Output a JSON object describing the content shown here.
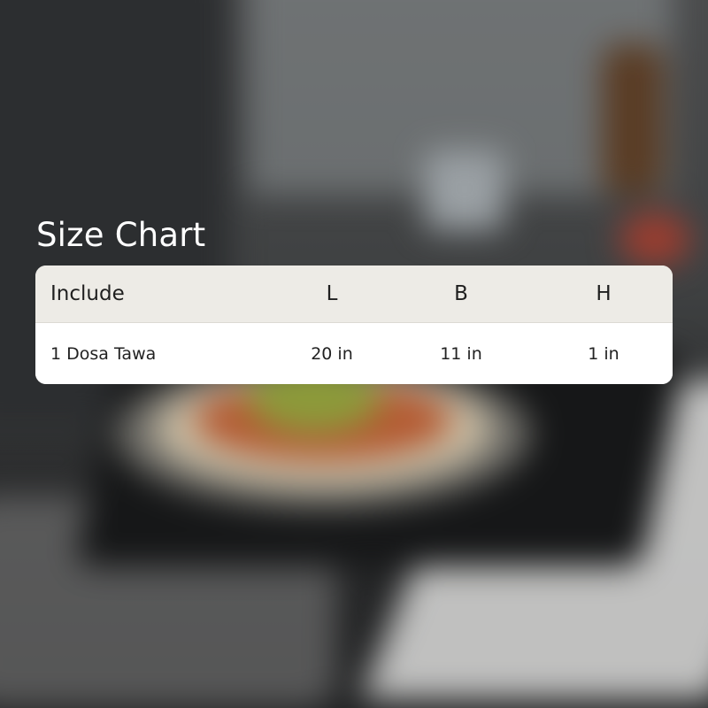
{
  "title": "Size Chart",
  "table": {
    "headers": {
      "include": "Include",
      "l": "L",
      "b": "B",
      "h": "H"
    },
    "rows": [
      {
        "include": "1 Dosa Tawa",
        "l": "20 in",
        "b": "11 in",
        "h": "1 in"
      }
    ]
  },
  "colors": {
    "title_text": "#ffffff",
    "header_bg": "#edebe6",
    "row_bg": "#ffffff"
  }
}
